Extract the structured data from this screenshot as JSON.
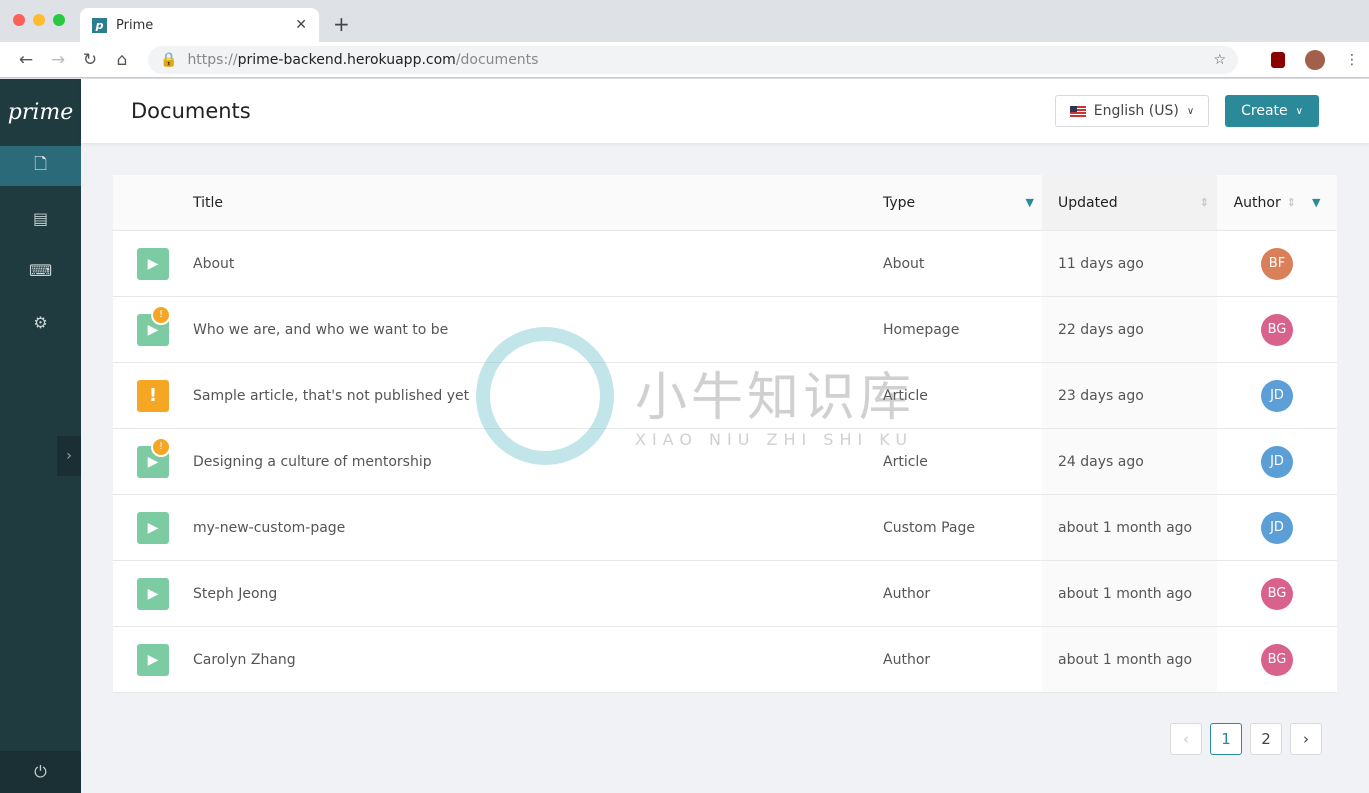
{
  "browser": {
    "tab_title": "Prime",
    "favicon_letter": "p",
    "url_scheme": "https://",
    "url_host": "prime-backend.herokuapp.com",
    "url_path": "/documents"
  },
  "sidebar": {
    "logo": "prime",
    "items": [
      {
        "icon": "document-icon",
        "glyph": "🗋"
      },
      {
        "icon": "schema-icon",
        "glyph": "▤"
      },
      {
        "icon": "terminal-icon",
        "glyph": "⌨"
      },
      {
        "icon": "settings-icon",
        "glyph": "⚙"
      }
    ],
    "collapse_glyph": "›",
    "logout_glyph": "⏻"
  },
  "header": {
    "title": "Documents",
    "locale": "English (US)",
    "create_label": "Create"
  },
  "table": {
    "columns": [
      "Title",
      "Type",
      "Updated",
      "Author"
    ],
    "rows": [
      {
        "status": "published",
        "warning": false,
        "title": "About",
        "type": "About",
        "updated": "11 days ago",
        "author": "BF",
        "author_color": "#d9805a"
      },
      {
        "status": "published",
        "warning": true,
        "title": "Who we are, and who we want to be",
        "type": "Homepage",
        "updated": "22 days ago",
        "author": "BG",
        "author_color": "#d9628c"
      },
      {
        "status": "draft",
        "warning": false,
        "title": "Sample article, that's not published yet",
        "type": "Article",
        "updated": "23 days ago",
        "author": "JD",
        "author_color": "#5b9fd6"
      },
      {
        "status": "published",
        "warning": true,
        "title": "Designing a culture of mentorship",
        "type": "Article",
        "updated": "24 days ago",
        "author": "JD",
        "author_color": "#5b9fd6"
      },
      {
        "status": "published",
        "warning": false,
        "title": "my-new-custom-page",
        "type": "Custom Page",
        "updated": "about 1 month ago",
        "author": "JD",
        "author_color": "#5b9fd6"
      },
      {
        "status": "published",
        "warning": false,
        "title": "Steph Jeong",
        "type": "Author",
        "updated": "about 1 month ago",
        "author": "BG",
        "author_color": "#d9628c"
      },
      {
        "status": "published",
        "warning": false,
        "title": "Carolyn Zhang",
        "type": "Author",
        "updated": "about 1 month ago",
        "author": "BG",
        "author_color": "#d9628c"
      }
    ]
  },
  "pagination": {
    "prev": "‹",
    "pages": [
      "1",
      "2"
    ],
    "current": "1",
    "next": "›"
  },
  "watermark": {
    "cn": "小牛知识库",
    "en": "XIAO NIU ZHI SHI KU"
  },
  "colors": {
    "accent": "#2b8a99",
    "sidebar": "#203b40",
    "published": "#7ccba2",
    "warning": "#f5a623"
  }
}
